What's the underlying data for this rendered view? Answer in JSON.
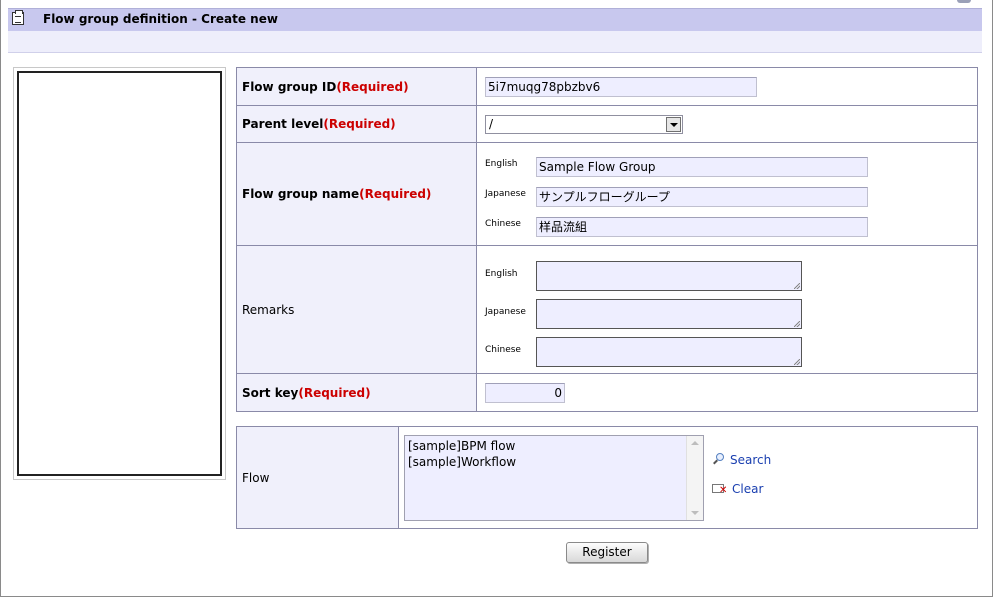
{
  "header": {
    "title": "Flow group definition - Create new"
  },
  "form": {
    "flow_group_id": {
      "label": "Flow group ID",
      "required": "(Required)",
      "value": "5i7muqg78pbzbv6"
    },
    "parent_level": {
      "label": "Parent level",
      "required": "(Required)",
      "value": "/"
    },
    "flow_group_name": {
      "label": "Flow group name",
      "required": "(Required)",
      "languages": [
        {
          "lang": "English",
          "value": "Sample Flow Group"
        },
        {
          "lang": "Japanese",
          "value": "サンプルフローグループ"
        },
        {
          "lang": "Chinese",
          "value": "样品流組"
        }
      ]
    },
    "remarks": {
      "label": "Remarks",
      "languages": [
        {
          "lang": "English",
          "value": ""
        },
        {
          "lang": "Japanese",
          "value": ""
        },
        {
          "lang": "Chinese",
          "value": ""
        }
      ]
    },
    "sort_key": {
      "label": "Sort key",
      "required": "(Required)",
      "value": "0"
    }
  },
  "flow": {
    "label": "Flow",
    "items": [
      "[sample]BPM flow",
      "[sample]Workflow"
    ],
    "search_label": "Search",
    "clear_label": "Clear"
  },
  "register_label": "Register"
}
